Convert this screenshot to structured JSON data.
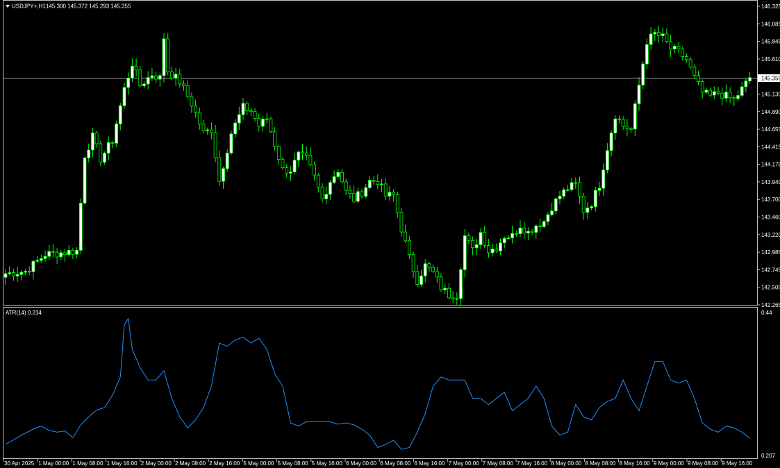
{
  "header": {
    "symbol": "USDJPY+,H1",
    "ohlc": "145.300 145.372 145.293 145.355",
    "indicator": "ATR(14) 0.234",
    "current_price": "145.355"
  },
  "colors": {
    "background": "#000000",
    "frame": "#c0c0c0",
    "bull": "#ffffff",
    "wick": "#00ff00",
    "bear": "#000000",
    "atr_line": "#1e90ff",
    "bid_line": "#a0a0a0"
  },
  "chart_data": [
    {
      "type": "candlestick",
      "title": "USDJPY+,H1",
      "y_ticks": [
        "146.325",
        "146.085",
        "145.845",
        "145.610",
        "145.355",
        "145.130",
        "144.890",
        "144.655",
        "144.415",
        "144.175",
        "143.940",
        "143.700",
        "143.460",
        "143.220",
        "142.985",
        "142.745",
        "142.505",
        "142.265"
      ],
      "ylim": [
        142.265,
        146.325
      ],
      "current_price": 145.355,
      "anchors": [
        [
          0,
          142.69
        ],
        [
          5,
          142.72
        ],
        [
          10,
          142.95
        ],
        [
          15,
          142.98
        ],
        [
          18,
          143.0
        ],
        [
          20,
          144.3
        ],
        [
          22,
          144.55
        ],
        [
          24,
          144.25
        ],
        [
          27,
          144.5
        ],
        [
          30,
          145.2
        ],
        [
          32,
          145.55
        ],
        [
          34,
          145.25
        ],
        [
          37,
          145.4
        ],
        [
          39,
          145.35
        ],
        [
          40,
          145.9
        ],
        [
          41,
          145.45
        ],
        [
          44,
          145.3
        ],
        [
          47,
          145.0
        ],
        [
          50,
          144.6
        ],
        [
          52,
          144.65
        ],
        [
          54,
          143.95
        ],
        [
          57,
          144.6
        ],
        [
          60,
          144.95
        ],
        [
          62,
          144.9
        ],
        [
          64,
          144.7
        ],
        [
          66,
          144.8
        ],
        [
          70,
          144.1
        ],
        [
          72,
          144.1
        ],
        [
          74,
          144.3
        ],
        [
          76,
          144.25
        ],
        [
          78,
          144.0
        ],
        [
          80,
          143.7
        ],
        [
          82,
          143.95
        ],
        [
          84,
          144.1
        ],
        [
          86,
          143.8
        ],
        [
          88,
          143.7
        ],
        [
          90,
          143.8
        ],
        [
          92,
          143.95
        ],
        [
          94,
          143.95
        ],
        [
          96,
          143.75
        ],
        [
          98,
          143.75
        ],
        [
          100,
          143.3
        ],
        [
          102,
          142.9
        ],
        [
          104,
          142.6
        ],
        [
          106,
          142.8
        ],
        [
          108,
          142.7
        ],
        [
          110,
          142.5
        ],
        [
          112,
          142.4
        ],
        [
          114,
          142.4
        ],
        [
          116,
          143.2
        ],
        [
          118,
          143.0
        ],
        [
          120,
          143.25
        ],
        [
          122,
          143.0
        ],
        [
          124,
          143.05
        ],
        [
          126,
          143.2
        ],
        [
          128,
          143.2
        ],
        [
          130,
          143.35
        ],
        [
          132,
          143.25
        ],
        [
          134,
          143.35
        ],
        [
          136,
          143.4
        ],
        [
          138,
          143.6
        ],
        [
          140,
          143.75
        ],
        [
          142,
          143.85
        ],
        [
          144,
          143.9
        ],
        [
          146,
          143.55
        ],
        [
          148,
          143.65
        ],
        [
          150,
          143.9
        ],
        [
          152,
          144.4
        ],
        [
          154,
          144.85
        ],
        [
          156,
          144.7
        ],
        [
          158,
          144.65
        ],
        [
          160,
          145.25
        ],
        [
          162,
          145.85
        ],
        [
          164,
          145.95
        ],
        [
          166,
          145.9
        ],
        [
          168,
          145.75
        ],
        [
          170,
          145.7
        ],
        [
          172,
          145.6
        ],
        [
          174,
          145.35
        ],
        [
          176,
          145.15
        ],
        [
          178,
          145.1
        ],
        [
          180,
          145.15
        ],
        [
          182,
          145.1
        ],
        [
          184,
          145.05
        ],
        [
          186,
          145.2
        ],
        [
          188,
          145.35
        ]
      ]
    },
    {
      "type": "line",
      "title": "ATR(14) 0.234",
      "ylim": [
        0.207,
        0.44
      ],
      "y_ticks": [
        "0.44",
        "0.207"
      ],
      "points": [
        [
          0,
          0.225
        ],
        [
          4,
          0.24
        ],
        [
          7,
          0.25
        ],
        [
          9,
          0.255
        ],
        [
          11,
          0.248
        ],
        [
          13,
          0.245
        ],
        [
          15,
          0.247
        ],
        [
          17,
          0.236
        ],
        [
          19,
          0.257
        ],
        [
          21,
          0.27
        ],
        [
          23,
          0.281
        ],
        [
          25,
          0.285
        ],
        [
          27,
          0.305
        ],
        [
          29,
          0.335
        ],
        [
          30,
          0.42
        ],
        [
          31,
          0.43
        ],
        [
          32,
          0.38
        ],
        [
          34,
          0.35
        ],
        [
          36,
          0.33
        ],
        [
          38,
          0.33
        ],
        [
          40,
          0.345
        ],
        [
          42,
          0.3
        ],
        [
          44,
          0.27
        ],
        [
          46,
          0.252
        ],
        [
          48,
          0.265
        ],
        [
          50,
          0.285
        ],
        [
          52,
          0.32
        ],
        [
          54,
          0.39
        ],
        [
          56,
          0.385
        ],
        [
          58,
          0.395
        ],
        [
          60,
          0.4
        ],
        [
          62,
          0.39
        ],
        [
          64,
          0.398
        ],
        [
          66,
          0.38
        ],
        [
          68,
          0.34
        ],
        [
          70,
          0.32
        ],
        [
          72,
          0.26
        ],
        [
          74,
          0.255
        ],
        [
          76,
          0.262
        ],
        [
          78,
          0.262
        ],
        [
          80,
          0.263
        ],
        [
          82,
          0.262
        ],
        [
          84,
          0.258
        ],
        [
          86,
          0.26
        ],
        [
          88,
          0.257
        ],
        [
          90,
          0.25
        ],
        [
          92,
          0.24
        ],
        [
          94,
          0.22
        ],
        [
          96,
          0.225
        ],
        [
          98,
          0.232
        ],
        [
          100,
          0.217
        ],
        [
          102,
          0.22
        ],
        [
          104,
          0.245
        ],
        [
          106,
          0.275
        ],
        [
          108,
          0.32
        ],
        [
          110,
          0.335
        ],
        [
          112,
          0.33
        ],
        [
          114,
          0.33
        ],
        [
          116,
          0.33
        ],
        [
          118,
          0.3
        ],
        [
          120,
          0.3
        ],
        [
          122,
          0.29
        ],
        [
          124,
          0.3
        ],
        [
          126,
          0.31
        ],
        [
          128,
          0.28
        ],
        [
          130,
          0.29
        ],
        [
          132,
          0.3
        ],
        [
          134,
          0.32
        ],
        [
          136,
          0.3
        ],
        [
          138,
          0.255
        ],
        [
          140,
          0.24
        ],
        [
          142,
          0.245
        ],
        [
          144,
          0.29
        ],
        [
          146,
          0.27
        ],
        [
          148,
          0.265
        ],
        [
          150,
          0.285
        ],
        [
          152,
          0.295
        ],
        [
          154,
          0.3
        ],
        [
          156,
          0.33
        ],
        [
          158,
          0.3
        ],
        [
          160,
          0.28
        ],
        [
          162,
          0.32
        ],
        [
          164,
          0.36
        ],
        [
          166,
          0.36
        ],
        [
          168,
          0.33
        ],
        [
          170,
          0.325
        ],
        [
          172,
          0.33
        ],
        [
          174,
          0.3
        ],
        [
          176,
          0.26
        ],
        [
          178,
          0.25
        ],
        [
          180,
          0.245
        ],
        [
          182,
          0.255
        ],
        [
          184,
          0.252
        ],
        [
          186,
          0.245
        ],
        [
          188,
          0.235
        ]
      ]
    }
  ],
  "x_axis": {
    "labels": [
      "30 Apr 2025",
      "1 May 00:00",
      "1 May 08:00",
      "1 May 16:00",
      "2 May 00:00",
      "2 May 08:00",
      "2 May 16:00",
      "5 May 00:00",
      "5 May 08:00",
      "5 May 16:00",
      "6 May 00:00",
      "6 May 08:00",
      "6 May 16:00",
      "7 May 00:00",
      "7 May 08:00",
      "7 May 16:00",
      "8 May 00:00",
      "8 May 08:00",
      "8 May 16:00",
      "9 May 00:00",
      "9 May 08:00",
      "9 May 16:00"
    ]
  }
}
